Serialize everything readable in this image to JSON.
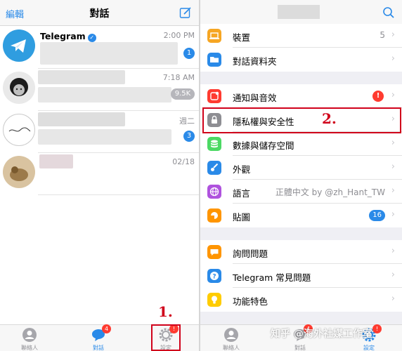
{
  "chats_screen": {
    "edit_label": "編輯",
    "title": "對話",
    "chats": [
      {
        "name": "Telegram",
        "verified": true,
        "time": "2:00 PM",
        "badge": "1"
      },
      {
        "name": "",
        "time": "7:18 AM",
        "badge": "9.5K"
      },
      {
        "name": "",
        "time": "週二",
        "badge": "3"
      },
      {
        "name": "",
        "time": "02/18",
        "badge": ""
      }
    ],
    "tabs": [
      {
        "label": "聯絡人"
      },
      {
        "label": "對話",
        "badge": "4"
      },
      {
        "label": "設定",
        "badge": "!"
      }
    ],
    "step_marker": "1."
  },
  "settings_screen": {
    "rows": [
      {
        "label": "裝置",
        "value": "5",
        "icon": "laptop-icon",
        "color": "#f6a623"
      },
      {
        "label": "對話資料夾",
        "icon": "folder-icon",
        "color": "#2a8ae8"
      },
      {
        "label": "通知與音效",
        "badge": "!",
        "icon": "bell-icon",
        "color": "#ff3b30"
      },
      {
        "label": "隱私權與安全性",
        "icon": "lock-icon",
        "color": "#8e8e93"
      },
      {
        "label": "數據與儲存空間",
        "icon": "database-icon",
        "color": "#4cd964"
      },
      {
        "label": "外觀",
        "icon": "brush-icon",
        "color": "#2a8ae8"
      },
      {
        "label": "語言",
        "value": "正體中文 by @zh_Hant_TW",
        "icon": "globe-icon",
        "color": "#af52de"
      },
      {
        "label": "貼圖",
        "badge": "16",
        "icon": "sticker-icon",
        "color": "#ff9500"
      },
      {
        "label": "詢問問題",
        "icon": "chat-bubble-icon",
        "color": "#ff9500"
      },
      {
        "label": "Telegram 常見問題",
        "icon": "question-icon",
        "color": "#2a8ae8"
      },
      {
        "label": "功能特色",
        "icon": "lightbulb-icon",
        "color": "#ffcc00"
      }
    ],
    "tabs": [
      {
        "label": "聯絡人"
      },
      {
        "label": "對話",
        "badge": "4"
      },
      {
        "label": "設定",
        "badge": "!"
      }
    ],
    "step_marker": "2.",
    "watermark": "知乎 @海外社媒工作室"
  },
  "colors": {
    "accent": "#2a8ae8",
    "highlight": "#d0021b",
    "badge_red": "#ff3b30"
  }
}
